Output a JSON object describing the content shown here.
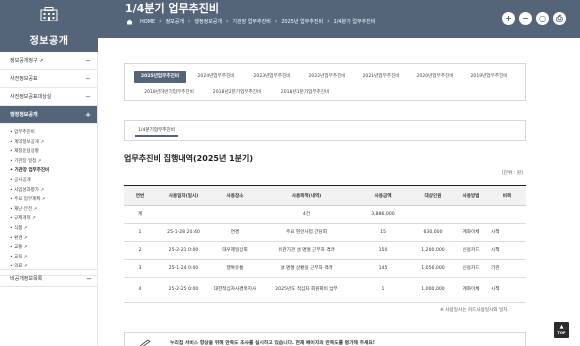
{
  "site": {
    "section_title": "정보공개"
  },
  "page": {
    "title": "1/4분기 업무추진비",
    "breadcrumb": [
      "HOME",
      "정보공개",
      "행정정보공개",
      "기관장 업무추진비",
      "2025년 업무추진비",
      "1/4분기 업무추진비"
    ]
  },
  "tools": {
    "zoom_in": "+",
    "zoom_out": "−",
    "reset": "○",
    "print": "⎙"
  },
  "sidebar": {
    "items": [
      {
        "label": "정보공개청구 ↗"
      },
      {
        "label": "사전정보공표"
      },
      {
        "label": "사전정보공표대상실"
      }
    ],
    "active": {
      "label": "행정정보공개",
      "toggle": "+"
    },
    "sub_items": [
      "업무추진비",
      "계약정보공개 ↗",
      "재정운용상황",
      "기관장 일정 ↗",
      "기관장 업무추진비",
      "공사공개",
      "사업성과평가 ↗",
      "주요 업무계획 ↗",
      "재난·안전 ↗",
      "규제개혁 ↗",
      "식품 ↗",
      "환경 ↗",
      "교통 ↗",
      "교육 ↗",
      "의료 ↗"
    ],
    "bottom": {
      "label": "비공개정보목록",
      "toggle": "−"
    },
    "minus": "−"
  },
  "year_tabs": [
    "2025년업무추진비",
    "2024년업무추진비",
    "2023년업무추진비",
    "2022년업무추진비",
    "2021년업무추진비",
    "2020년업무추진비",
    "2019년업무추진비",
    "2018년하반기업무추진비",
    "2018년2분기업무추진비",
    "2018년1분기업무추진비"
  ],
  "quarter_tab": "1/4분기업무추진비",
  "section": {
    "title": "업무추진비 집행내역(2025년 1분기)",
    "unit": "[단위 : 원]"
  },
  "table": {
    "headers": [
      "연번",
      "사용일자(일시)",
      "사용장소",
      "사용목적(내역)",
      "사용금액",
      "대상인원",
      "사용방법",
      "비목"
    ],
    "rows": [
      [
        "계",
        "",
        "",
        "4건",
        "3,886,000",
        "",
        "",
        ""
      ],
      [
        "1",
        "25-1-28 20:40",
        "연경",
        "주요 현안사업 간담회",
        "15",
        "630,000",
        "계좌이체",
        "시책"
      ],
      [
        "2",
        "25-2-21 0:00",
        "대우제일상회",
        "유관기관 설 명절 근무자 격려",
        "150",
        "1,200,000",
        "신용카드",
        "시책"
      ],
      [
        "3",
        "25-1-24 0:00",
        "행복유통",
        "설 명절 상황실 근무자 격려",
        "145",
        "1,056,000",
        "신용카드",
        "기관"
      ],
      [
        "4",
        "25-2-25 0:00",
        "대한적십자사경북지사",
        "2025년도 적십자 회원회비 납부",
        "1",
        "1,000,000",
        "계좌이체",
        "시책"
      ]
    ]
  },
  "note": "※ 사용일시는 카드사용일시와 일치.",
  "survey": {
    "text": "누리집 서비스 향상을 위해 만족도 조사를 실시하고 있습니다. 현재 페이지의 만족도를 평가해 주세요!"
  },
  "top_button": {
    "arrow": "▲",
    "label": "TOP"
  },
  "colors": {
    "header": "#54657a",
    "active_tab": "#54657a",
    "table_header_bg": "#f2f2f2"
  }
}
